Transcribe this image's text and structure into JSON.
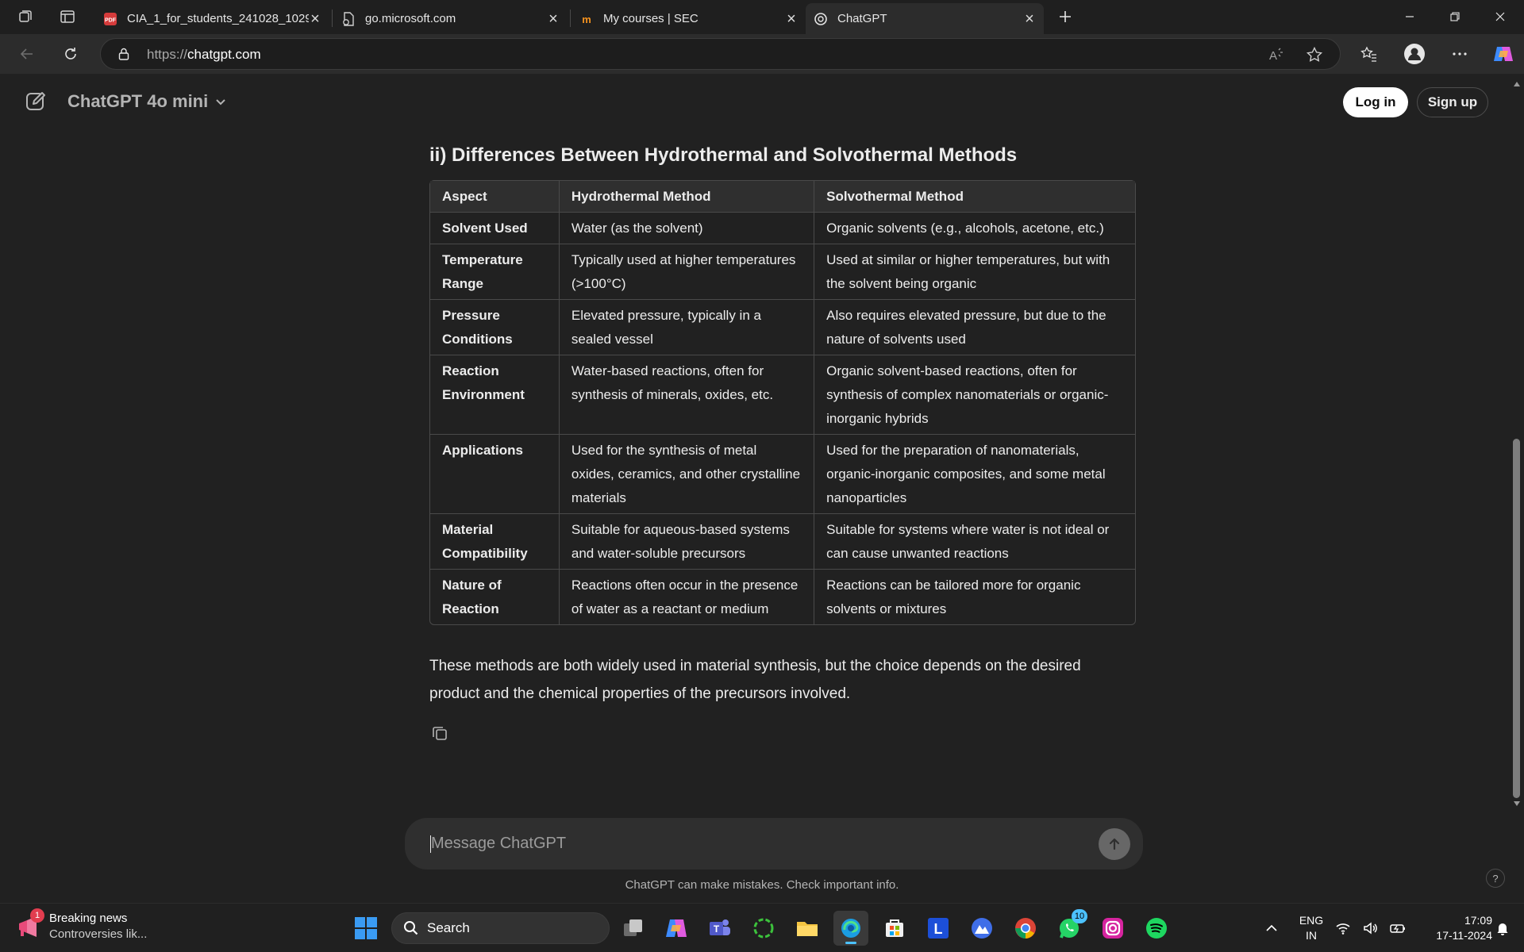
{
  "browser": {
    "tabs": [
      {
        "title": "CIA_1_for_students_241028_1029…",
        "icon": "pdf-icon"
      },
      {
        "title": "go.microsoft.com",
        "icon": "document-icon"
      },
      {
        "title": "My courses | SEC",
        "icon": "moodle-icon"
      },
      {
        "title": "ChatGPT",
        "icon": "chatgpt-icon"
      }
    ],
    "url_protocol": "https://",
    "url_host": "chatgpt.com"
  },
  "header": {
    "model_label": "ChatGPT 4o mini",
    "login_label": "Log in",
    "signup_label": "Sign up"
  },
  "content": {
    "heading": "ii) Differences Between Hydrothermal and Solvothermal Methods",
    "table": {
      "headers": [
        "Aspect",
        "Hydrothermal Method",
        "Solvothermal Method"
      ],
      "rows": [
        [
          "Solvent Used",
          "Water (as the solvent)",
          "Organic solvents (e.g., alcohols, acetone, etc.)"
        ],
        [
          "Temperature Range",
          "Typically used at higher temperatures (>100°C)",
          "Used at similar or higher temperatures, but with the solvent being organic"
        ],
        [
          "Pressure Conditions",
          "Elevated pressure, typically in a sealed vessel",
          "Also requires elevated pressure, but due to the nature of solvents used"
        ],
        [
          "Reaction Environment",
          "Water-based reactions, often for synthesis of minerals, oxides, etc.",
          "Organic solvent-based reactions, often for synthesis of complex nanomaterials or organic-inorganic hybrids"
        ],
        [
          "Applications",
          "Used for the synthesis of metal oxides, ceramics, and other crystalline materials",
          "Used for the preparation of nanomaterials, organic-inorganic composites, and some metal nanoparticles"
        ],
        [
          "Material Compatibility",
          "Suitable for aqueous-based systems and water-soluble precursors",
          "Suitable for systems where water is not ideal or can cause unwanted reactions"
        ],
        [
          "Nature of Reaction",
          "Reactions often occur in the presence of water as a reactant or medium",
          "Reactions can be tailored more for organic solvents or mixtures"
        ]
      ]
    },
    "summary": "These methods are both widely used in material synthesis, but the choice depends on the desired product and the chemical properties of the precursors involved."
  },
  "composer": {
    "placeholder": "Message ChatGPT",
    "disclaimer": "ChatGPT can make mistakes. Check important info.",
    "help_label": "?"
  },
  "taskbar": {
    "news_badge": "1",
    "news_title": "Breaking news",
    "news_subtitle": "Controversies lik...",
    "search_label": "Search",
    "whatsapp_badge": "10",
    "lang_line1": "ENG",
    "lang_line2": "IN",
    "time": "17:09",
    "date": "17-11-2024",
    "launcher_letter": "L"
  },
  "colors": {
    "page_bg": "#212121",
    "accent": "#4cc2ff",
    "button_bg": "#ffffff"
  }
}
